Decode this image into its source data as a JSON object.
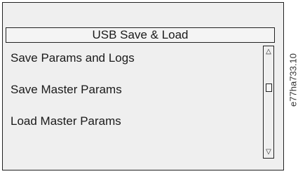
{
  "screen": {
    "title": "USB Save & Load",
    "menu_items": [
      {
        "label": "Save Params and Logs"
      },
      {
        "label": "Save Master Params"
      },
      {
        "label": "Load Master Params"
      }
    ],
    "scrollbar": {
      "up_icon": "triangle-up-icon",
      "down_icon": "triangle-down-icon"
    }
  },
  "figure_code": "e77ha733.10",
  "colors": {
    "panel_bg": "#efefef",
    "border": "#222222"
  }
}
